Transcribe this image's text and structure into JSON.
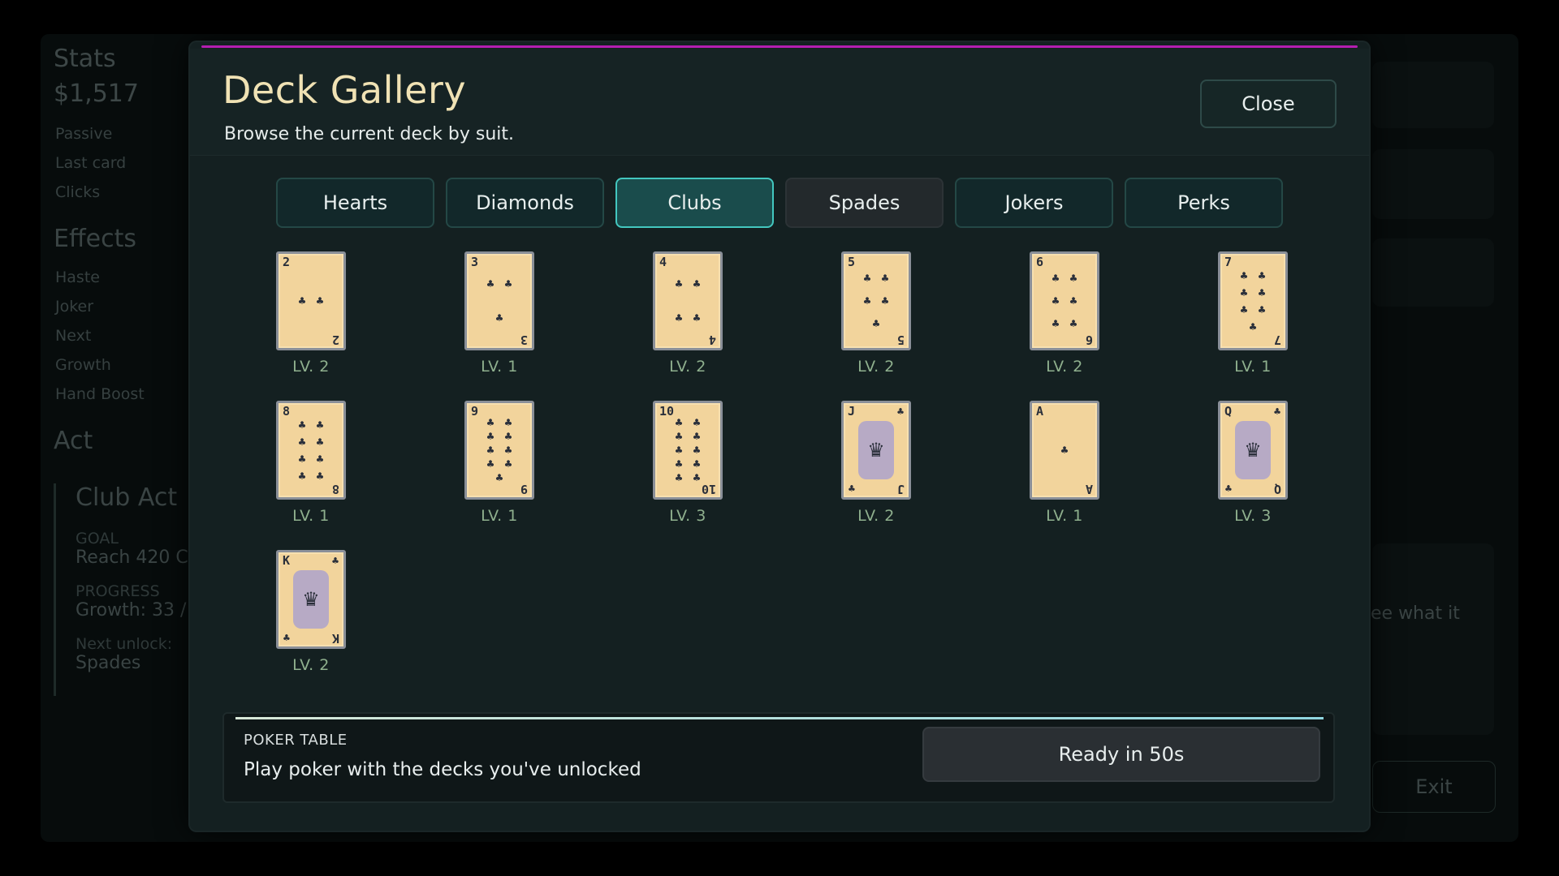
{
  "background": {
    "stats_title": "Stats",
    "money": "$1,517",
    "stats_rows": [
      "Passive",
      "Last card",
      "Clicks"
    ],
    "effects_title": "Effects",
    "effects_rows": [
      "Haste",
      "Joker",
      "Next",
      "Growth",
      "Hand Boost"
    ],
    "act_title": "Act",
    "act": {
      "name": "Club Act",
      "goal_label": "GOAL",
      "goal_value": "Reach 420 C",
      "progress_label": "PROGRESS",
      "progress_value": "Growth: 33 /",
      "next_label": "Next unlock:",
      "next_value": "Spades"
    },
    "right_text": "ee what it",
    "exit_label": "Exit"
  },
  "modal": {
    "title": "Deck Gallery",
    "subtitle": "Browse the current deck by suit.",
    "close_label": "Close",
    "tabs": [
      {
        "label": "Hearts",
        "state": "normal"
      },
      {
        "label": "Diamonds",
        "state": "normal"
      },
      {
        "label": "Clubs",
        "state": "active"
      },
      {
        "label": "Spades",
        "state": "dark"
      },
      {
        "label": "Jokers",
        "state": "normal"
      },
      {
        "label": "Perks",
        "state": "normal"
      }
    ],
    "suit_icon": "club-icon",
    "cards": [
      {
        "rank": "2",
        "level": "LV. 2",
        "pips": 2,
        "face": false
      },
      {
        "rank": "3",
        "level": "LV. 1",
        "pips": 3,
        "face": false
      },
      {
        "rank": "4",
        "level": "LV. 2",
        "pips": 4,
        "face": false
      },
      {
        "rank": "5",
        "level": "LV. 2",
        "pips": 5,
        "face": false
      },
      {
        "rank": "6",
        "level": "LV. 2",
        "pips": 6,
        "face": false
      },
      {
        "rank": "7",
        "level": "LV. 1",
        "pips": 7,
        "face": false
      },
      {
        "rank": "8",
        "level": "LV. 1",
        "pips": 8,
        "face": false
      },
      {
        "rank": "9",
        "level": "LV. 1",
        "pips": 9,
        "face": false
      },
      {
        "rank": "10",
        "level": "LV. 3",
        "pips": 10,
        "face": false
      },
      {
        "rank": "J",
        "level": "LV. 2",
        "pips": 0,
        "face": true
      },
      {
        "rank": "A",
        "level": "LV. 1",
        "pips": 1,
        "face": false
      },
      {
        "rank": "Q",
        "level": "LV. 3",
        "pips": 0,
        "face": true
      },
      {
        "rank": "K",
        "level": "LV. 2",
        "pips": 0,
        "face": true
      }
    ],
    "poker": {
      "label": "POKER TABLE",
      "description": "Play poker with the decks you've unlocked",
      "button_label": "Ready in 50s"
    }
  },
  "colors": {
    "accent_magenta": "#b41eb0",
    "active_tab": "#43c7bf",
    "card_bg": "#f2d49c",
    "level_text": "#8fb08e",
    "title_text": "#f0e2b4"
  }
}
